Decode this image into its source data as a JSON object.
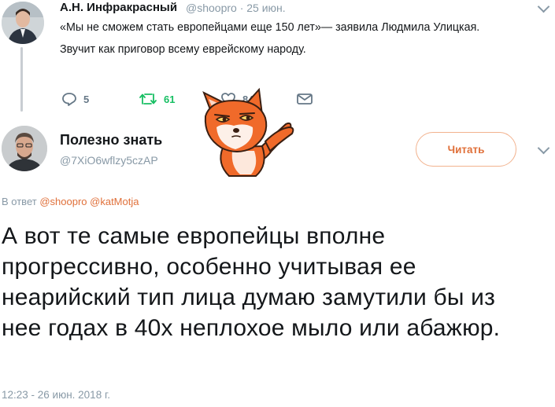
{
  "tweet1": {
    "author_name": "А.Н. Инфракрасный",
    "handle_time": "@shoopro · 25 июн.",
    "text_line1": "«Мы не сможем стать европейцами еще 150 лет»— заявила Людмила Улицкая.",
    "text_line2": "Звучит как приговор всему еврейскому народу.",
    "reply_count": "5",
    "retweet_count": "61",
    "like_count": "84"
  },
  "tweet2": {
    "author_name": "Полезно знать",
    "handle": "@7XiO6wflzy5czAP",
    "follow_label": "Читать",
    "reply_prefix": "В ответ",
    "mention1": "@shoopro",
    "mention2": "@katMotja",
    "text": "А вот те самые европейцы вполне прогрессивно, особенно учитывая ее неарийский тип лица думаю замутили бы из нее годах в 40х неплохое мыло или абажюр.",
    "timestamp": "12:23 - 26 июн. 2018 г."
  },
  "colors": {
    "accent": "#e0703a",
    "retweet": "#17bf63",
    "muted": "#8899a6"
  },
  "icons": [
    "reply-icon",
    "retweet-icon",
    "like-icon",
    "message-icon",
    "chevron-down-icon",
    "fox-sticker"
  ]
}
